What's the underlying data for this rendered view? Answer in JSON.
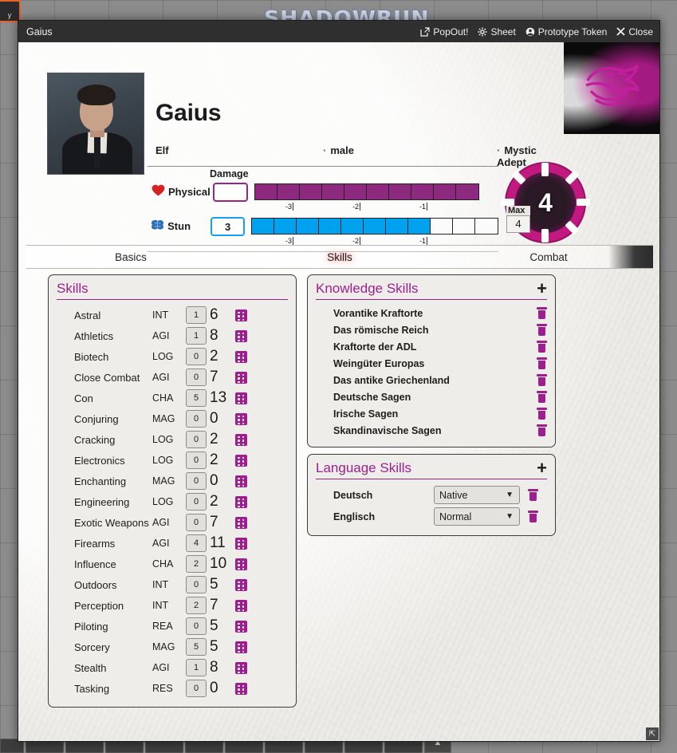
{
  "vtt": {
    "logo": "SHADOWRUN",
    "notice_text": "y"
  },
  "window": {
    "title": "Gaius",
    "controls": [
      {
        "label": "PopOut!",
        "icon": "popout-icon"
      },
      {
        "label": "Sheet",
        "icon": "gear-icon"
      },
      {
        "label": "Prototype Token",
        "icon": "user-circle-icon"
      },
      {
        "label": "Close",
        "icon": "close-icon"
      }
    ]
  },
  "character": {
    "name": "Gaius",
    "metatype": "Elf",
    "gender": "male",
    "archetype": "Mystic Adept",
    "separator": "·"
  },
  "tracks": {
    "damage_label": "Damage",
    "physical": {
      "label": "Physical",
      "icon": "heart-icon",
      "value": "",
      "boxes_total": 10,
      "boxes_filled": 10,
      "penalties": [
        "-3",
        "-2",
        "-1"
      ]
    },
    "stun": {
      "label": "Stun",
      "icon": "brain-icon",
      "value": "3",
      "boxes_total": 11,
      "boxes_filled": 8,
      "penalties": [
        "-3",
        "-2",
        "-1"
      ]
    }
  },
  "edge": {
    "value": "4",
    "max_label": "Max",
    "max_value": "4"
  },
  "tabs": [
    {
      "label": "Basics",
      "active": false
    },
    {
      "label": "Skills",
      "active": true
    },
    {
      "label": "Combat",
      "active": false
    }
  ],
  "skills_panel": {
    "title": "Skills",
    "rows": [
      {
        "name": "Astral",
        "attr": "INT",
        "rank": "1",
        "pool": "6"
      },
      {
        "name": "Athletics",
        "attr": "AGI",
        "rank": "1",
        "pool": "8"
      },
      {
        "name": "Biotech",
        "attr": "LOG",
        "rank": "0",
        "pool": "2"
      },
      {
        "name": "Close Combat",
        "attr": "AGI",
        "rank": "0",
        "pool": "7"
      },
      {
        "name": "Con",
        "attr": "CHA",
        "rank": "5",
        "pool": "13"
      },
      {
        "name": "Conjuring",
        "attr": "MAG",
        "rank": "0",
        "pool": "0"
      },
      {
        "name": "Cracking",
        "attr": "LOG",
        "rank": "0",
        "pool": "2"
      },
      {
        "name": "Electronics",
        "attr": "LOG",
        "rank": "0",
        "pool": "2"
      },
      {
        "name": "Enchanting",
        "attr": "MAG",
        "rank": "0",
        "pool": "0"
      },
      {
        "name": "Engineering",
        "attr": "LOG",
        "rank": "0",
        "pool": "2"
      },
      {
        "name": "Exotic Weapons",
        "attr": "AGI",
        "rank": "0",
        "pool": "7"
      },
      {
        "name": "Firearms",
        "attr": "AGI",
        "rank": "4",
        "pool": "11"
      },
      {
        "name": "Influence",
        "attr": "CHA",
        "rank": "2",
        "pool": "10"
      },
      {
        "name": "Outdoors",
        "attr": "INT",
        "rank": "0",
        "pool": "5"
      },
      {
        "name": "Perception",
        "attr": "INT",
        "rank": "2",
        "pool": "7"
      },
      {
        "name": "Piloting",
        "attr": "REA",
        "rank": "0",
        "pool": "5"
      },
      {
        "name": "Sorcery",
        "attr": "MAG",
        "rank": "5",
        "pool": "5"
      },
      {
        "name": "Stealth",
        "attr": "AGI",
        "rank": "1",
        "pool": "8"
      },
      {
        "name": "Tasking",
        "attr": "RES",
        "rank": "0",
        "pool": "0"
      }
    ]
  },
  "knowledge_panel": {
    "title": "Knowledge Skills",
    "add_label": "+",
    "rows": [
      {
        "name": "Vorantike Kraftorte"
      },
      {
        "name": "Das römische Reich"
      },
      {
        "name": "Kraftorte der ADL"
      },
      {
        "name": "Weingüter Europas"
      },
      {
        "name": "Das antike Griechenland"
      },
      {
        "name": "Deutsche Sagen"
      },
      {
        "name": "Irische Sagen"
      },
      {
        "name": "Skandinavische Sagen"
      }
    ]
  },
  "language_panel": {
    "title": "Language Skills",
    "add_label": "+",
    "rows": [
      {
        "name": "Deutsch",
        "level": "Native"
      },
      {
        "name": "Englisch",
        "level": "Normal"
      }
    ]
  },
  "colors": {
    "accent_magenta": "#9c1f8e",
    "physical_track": "#8d2a7f",
    "stun_track": "#00a2f0",
    "edge_chip": "#c2187f"
  }
}
